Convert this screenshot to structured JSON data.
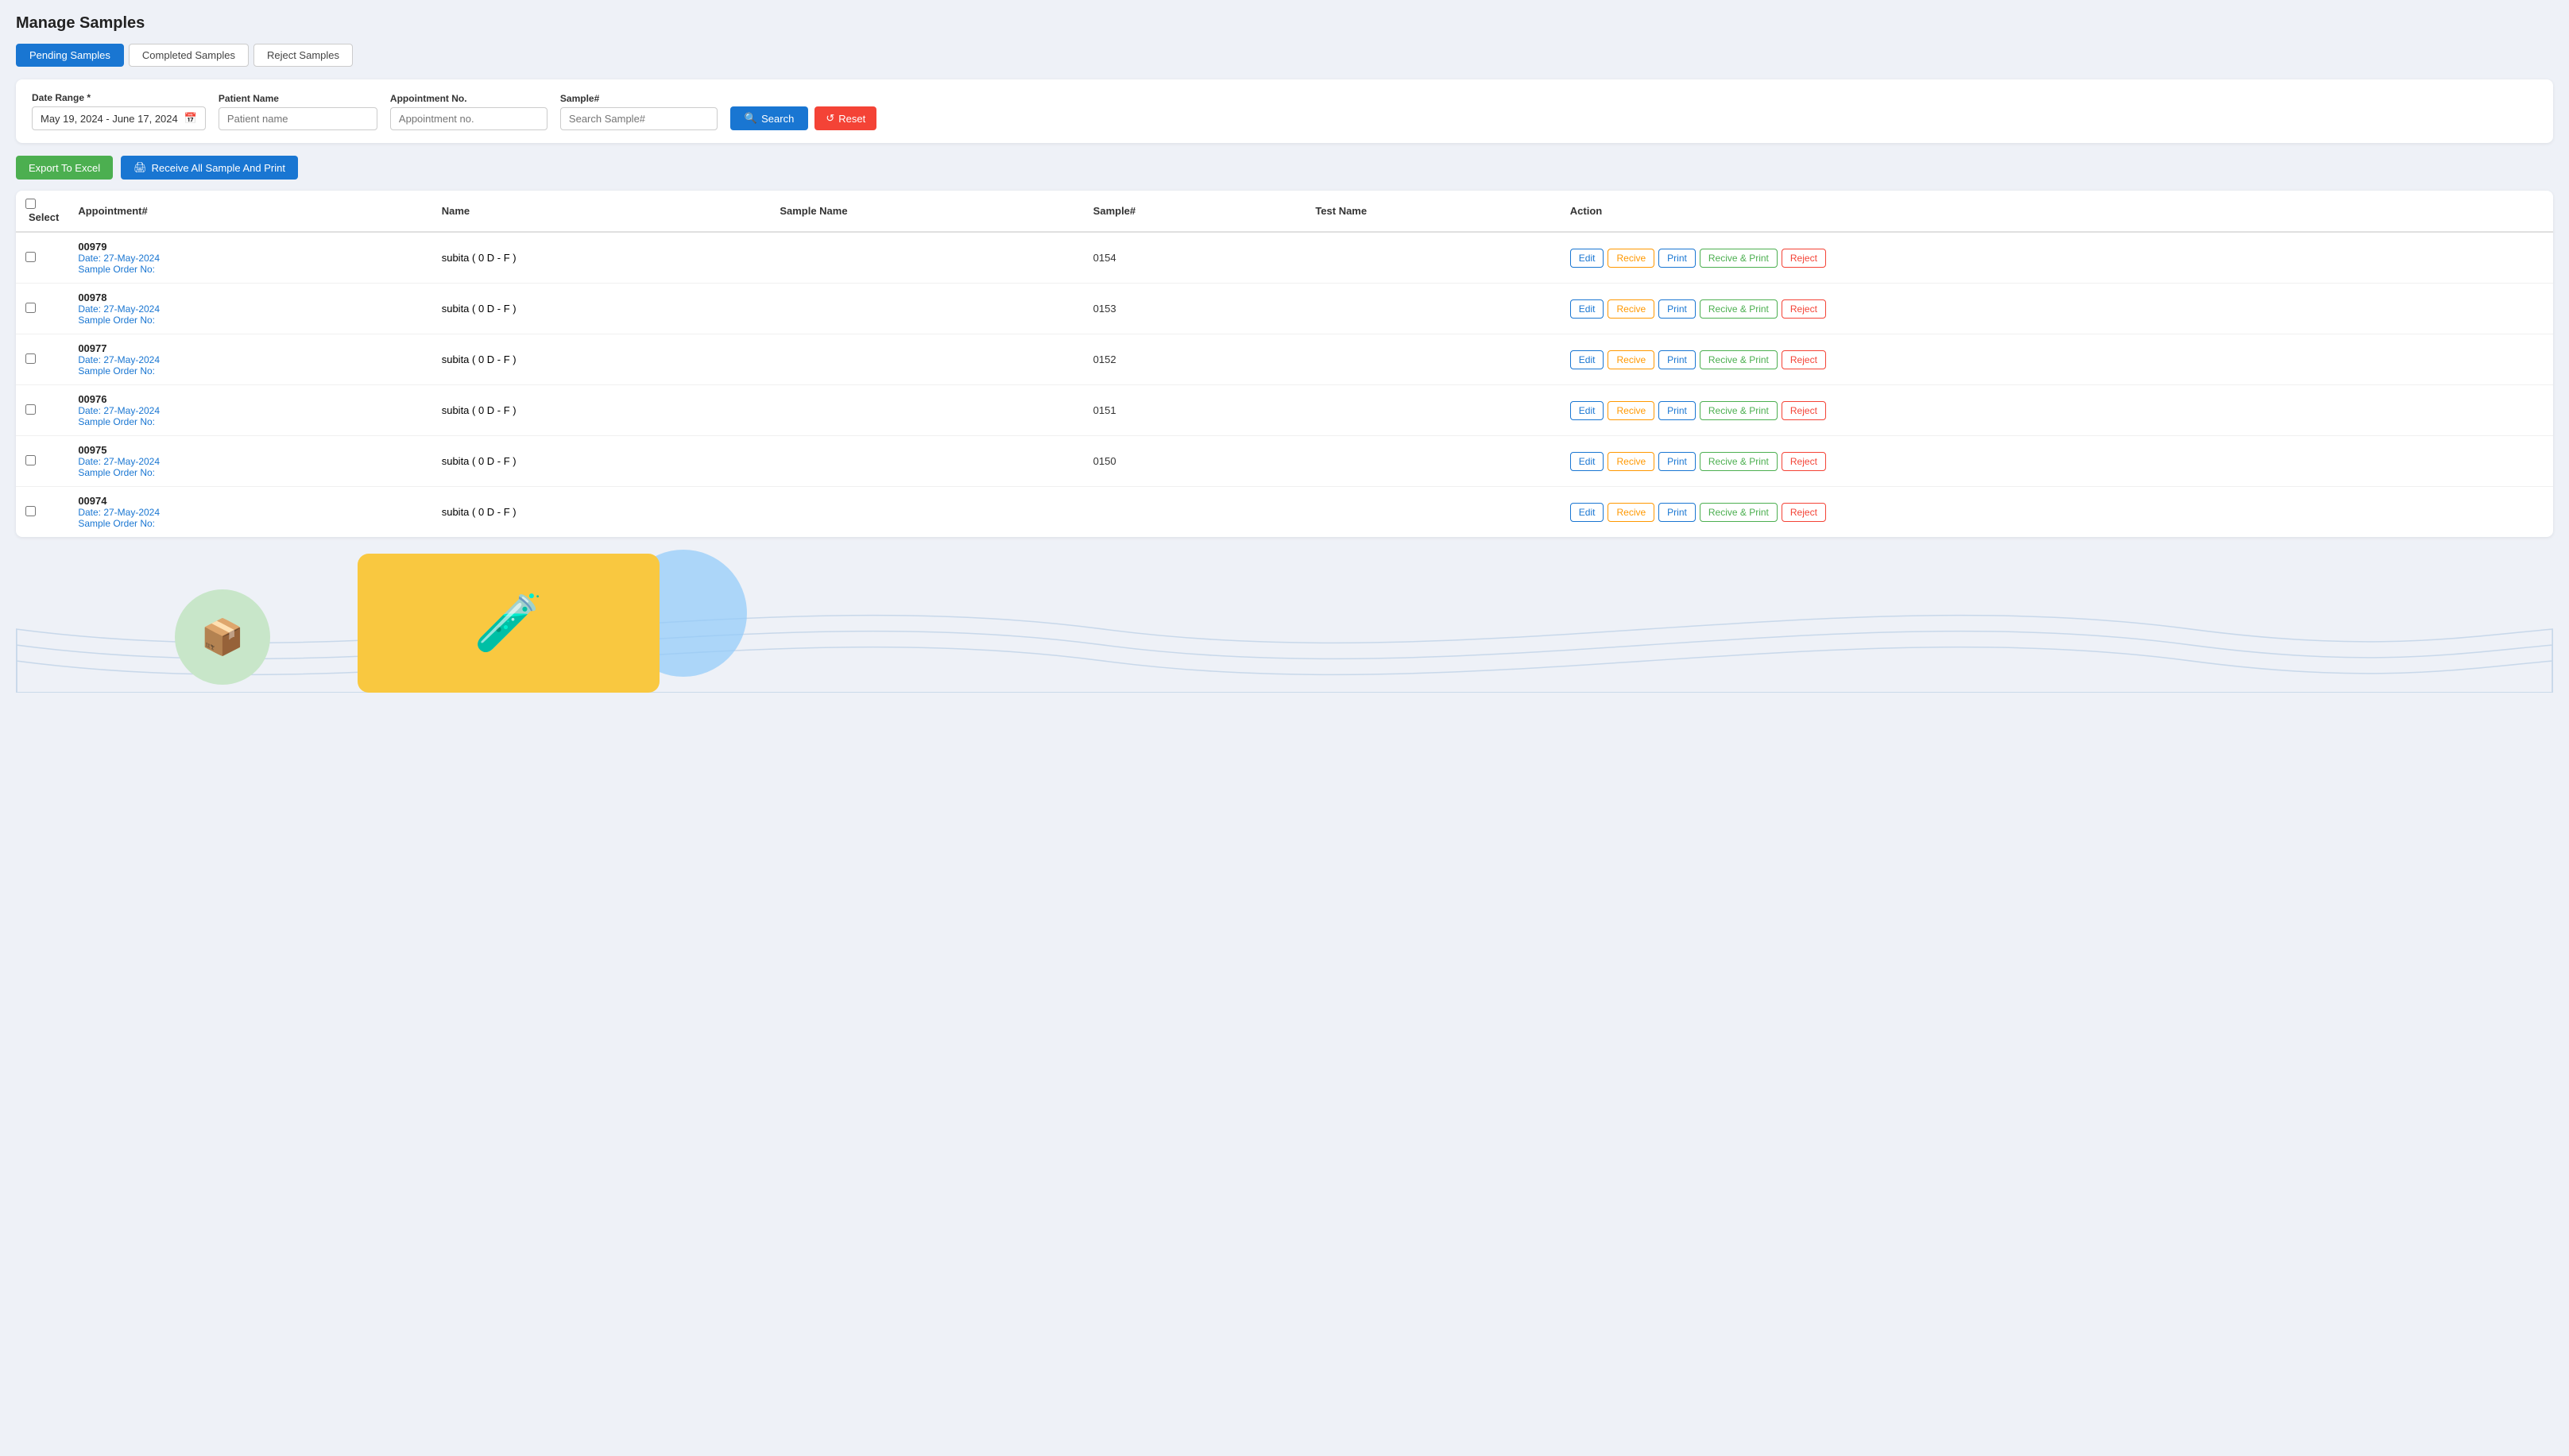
{
  "page": {
    "title": "Manage Samples"
  },
  "tabs": [
    {
      "label": "Pending Samples",
      "active": true
    },
    {
      "label": "Completed Samples",
      "active": false
    },
    {
      "label": "Reject Samples",
      "active": false
    }
  ],
  "filters": {
    "date_range_label": "Date Range *",
    "date_range_value": "May 19, 2024 - June 17, 2024",
    "patient_name_label": "Patient Name",
    "patient_name_placeholder": "Patient name",
    "appointment_no_label": "Appointment No.",
    "appointment_no_placeholder": "Appointment no.",
    "sample_label": "Sample#",
    "sample_placeholder": "Search Sample#",
    "search_btn": "Search",
    "reset_btn": "Reset"
  },
  "toolbar": {
    "export_excel": "Export To Excel",
    "receive_print": "Receive All Sample And Print"
  },
  "table": {
    "columns": [
      "Select",
      "Appointment#",
      "Name",
      "Sample Name",
      "Sample#",
      "Test Name",
      "Action"
    ],
    "rows": [
      {
        "appointment": "00979",
        "date": "Date: 27-May-2024",
        "order": "Sample Order No:",
        "name": "subita ( 0 D - F )",
        "sample_name": "",
        "sample_num": "0154",
        "test_name": ""
      },
      {
        "appointment": "00978",
        "date": "Date: 27-May-2024",
        "order": "Sample Order No:",
        "name": "subita ( 0 D - F )",
        "sample_name": "",
        "sample_num": "0153",
        "test_name": ""
      },
      {
        "appointment": "00977",
        "date": "Date: 27-May-2024",
        "order": "Sample Order No:",
        "name": "subita ( 0 D - F )",
        "sample_name": "",
        "sample_num": "0152",
        "test_name": ""
      },
      {
        "appointment": "00976",
        "date": "Date: 27-May-2024",
        "order": "Sample Order No:",
        "name": "subita ( 0 D - F )",
        "sample_name": "",
        "sample_num": "0151",
        "test_name": ""
      },
      {
        "appointment": "00975",
        "date": "Date: 27-May-2024",
        "order": "Sample Order No:",
        "name": "subita ( 0 D - F )",
        "sample_name": "",
        "sample_num": "0150",
        "test_name": ""
      },
      {
        "appointment": "00974",
        "date": "Date: 27-May-2024",
        "order": "Sample Order No:",
        "name": "subita ( 0 D - F )",
        "sample_name": "",
        "sample_num": "",
        "test_name": ""
      }
    ],
    "action_buttons": [
      "Edit",
      "Recive",
      "Print",
      "Recive & Print",
      "Reject"
    ]
  },
  "icons": {
    "search": "🔍",
    "reset": "↺",
    "print": "🖨",
    "calendar": "📅"
  }
}
